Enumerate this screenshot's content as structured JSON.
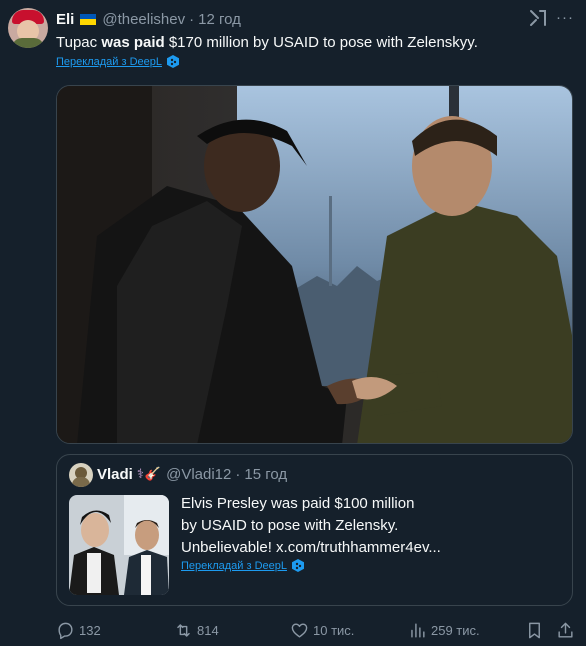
{
  "tweet": {
    "author_name": "Eli",
    "author_flag": "ukraine-flag",
    "handle": "@theelishev",
    "separator": "·",
    "time": "12 год",
    "text_before": "Tupac ",
    "text_bold": "was paid",
    "text_after": " $170 million by USAID to pose with Zelenskyy.",
    "translate_label": "Перекладай з DeepL",
    "media_alt": "photo"
  },
  "quote": {
    "author_name": "Vladi",
    "author_emoji": "⚕🎸",
    "handle": "@Vladi12",
    "separator": "·",
    "time": "15 год",
    "text_lines": [
      "Elvis Presley was paid $100 million",
      "by USAID to pose with Zelensky.",
      "Unbelievable!  x.com/truthhammer4ev..."
    ],
    "translate_label": "Перекладай з DeepL"
  },
  "actions": {
    "replies": "132",
    "reposts": "814",
    "likes": "10 тис.",
    "views": "259 тис."
  },
  "colors": {
    "background": "#15202b",
    "text": "#f7f9f9",
    "secondary": "#8b98a5",
    "link": "#1d9bf0",
    "border": "#38444d"
  },
  "icons": [
    "grok-icon",
    "more-icon",
    "deepl-icon",
    "reply-icon",
    "repost-icon",
    "like-icon",
    "views-icon",
    "bookmark-icon",
    "share-icon"
  ]
}
